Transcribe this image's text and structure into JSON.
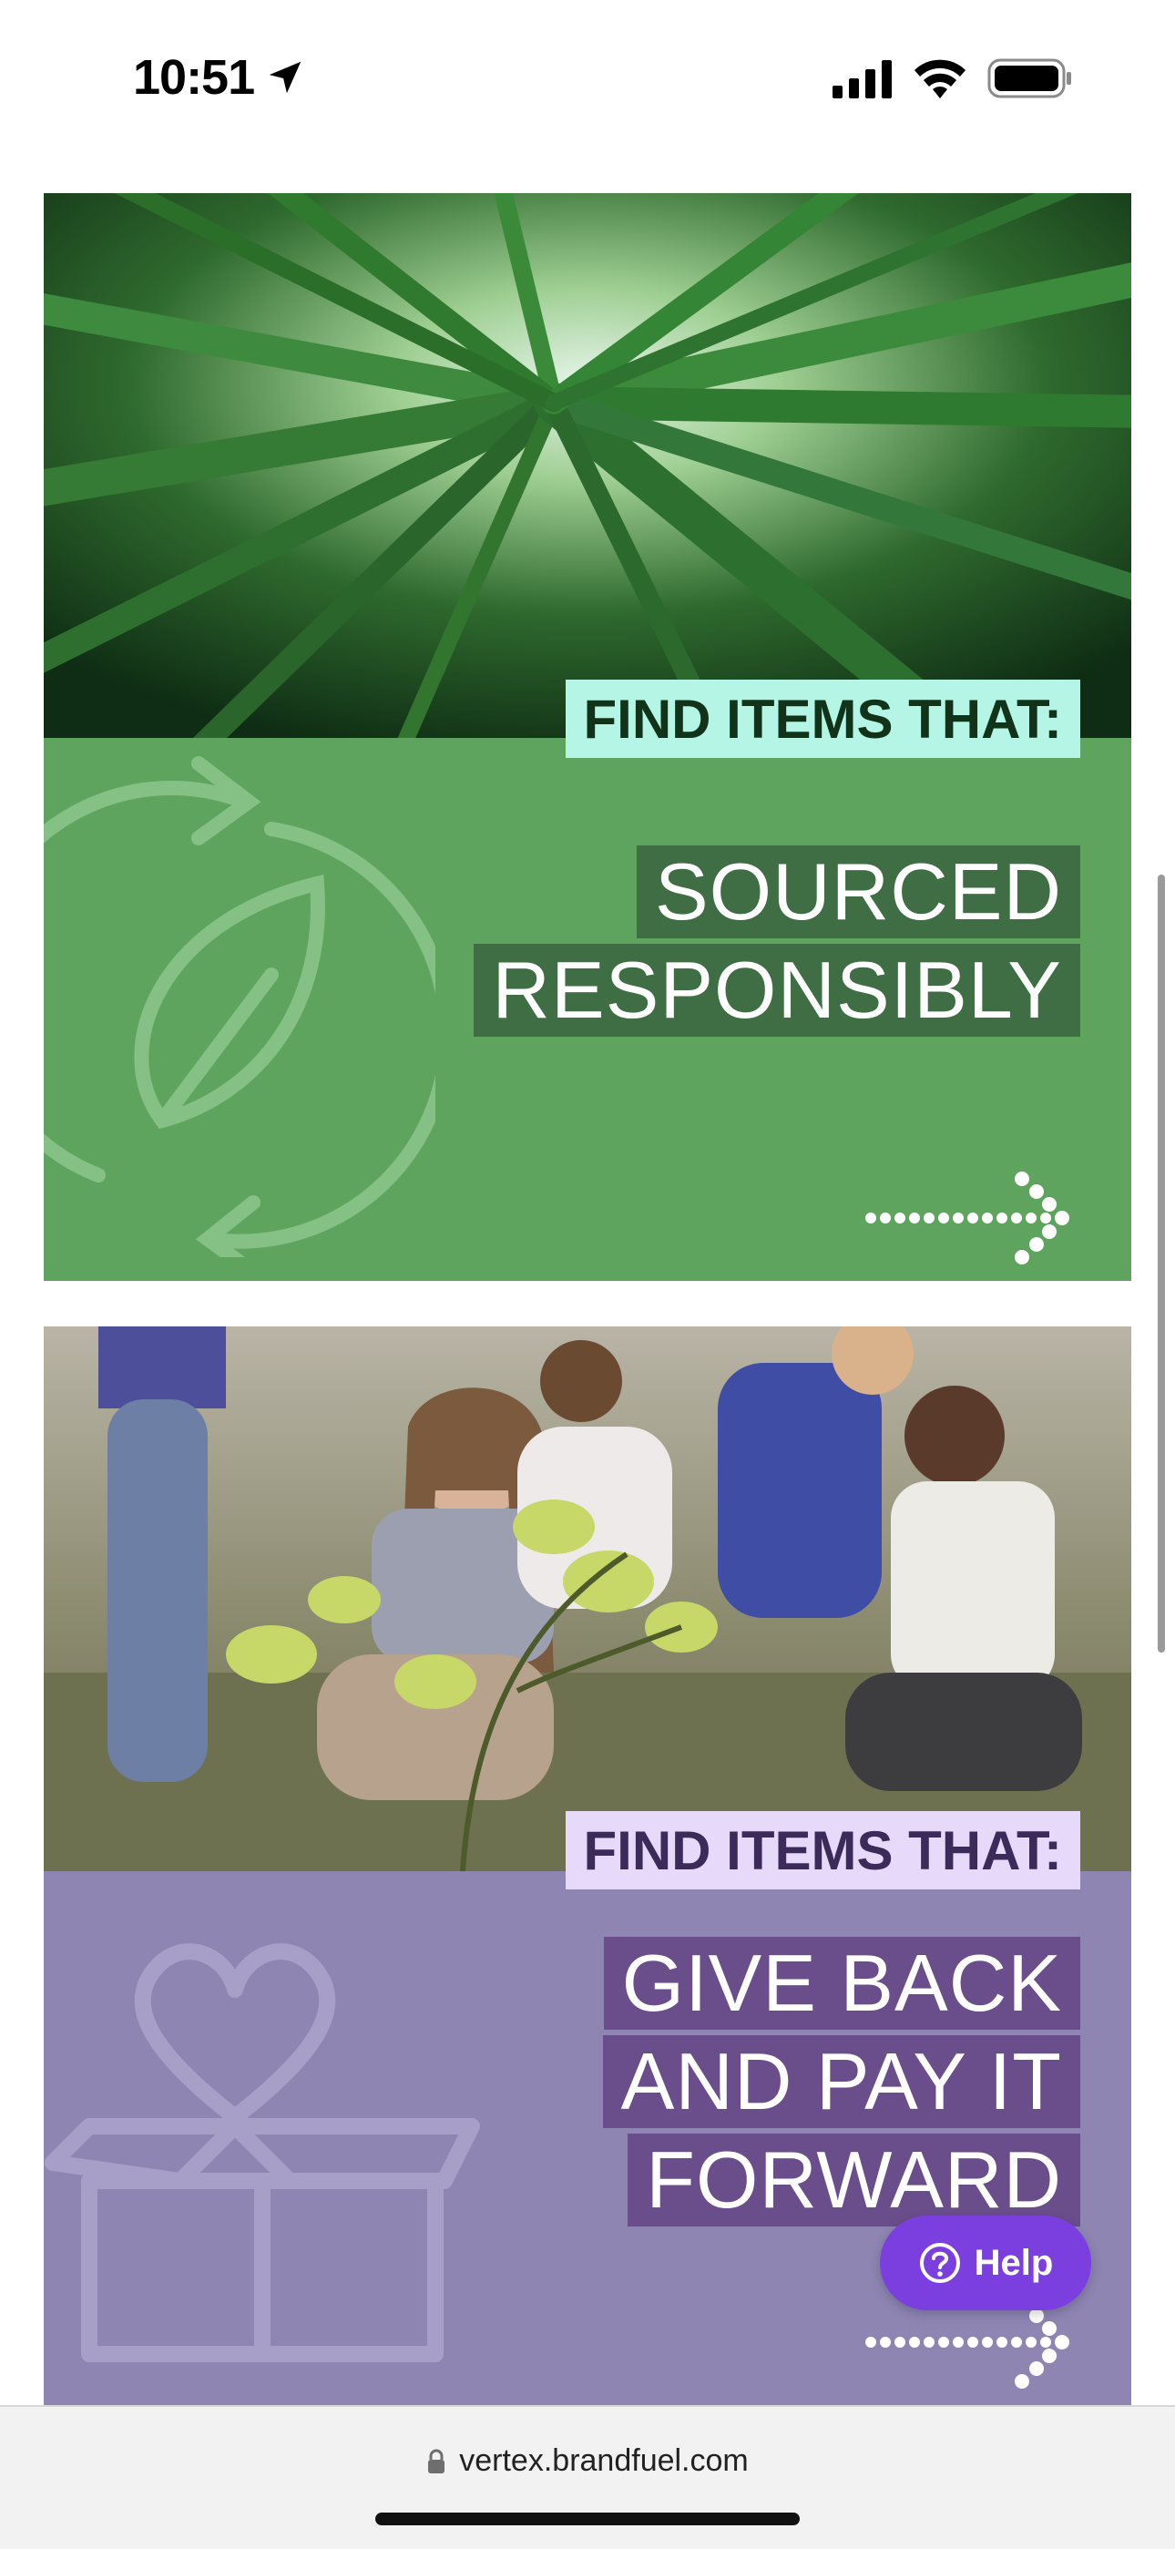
{
  "status_bar": {
    "time": "10:51"
  },
  "cards": [
    {
      "eyebrow": "FIND ITEMS THAT:",
      "headline": [
        "SOURCED",
        "RESPONSIBLY"
      ],
      "accent": "#5fa45e",
      "icon": "recycle-leaf-icon"
    },
    {
      "eyebrow": "FIND ITEMS THAT:",
      "headline": [
        "GIVE BACK",
        "AND PAY IT",
        "FORWARD"
      ],
      "accent": "#8e85b3",
      "icon": "heart-box-icon"
    }
  ],
  "help_button": {
    "label": "Help",
    "color": "#7b3fe0"
  },
  "browser": {
    "url": "vertex.brandfuel.com"
  }
}
